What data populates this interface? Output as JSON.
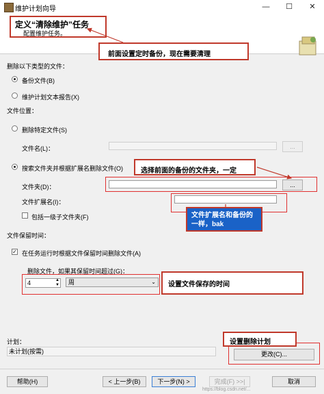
{
  "window": {
    "title": "维护计划向导",
    "minimize": "—",
    "maximize": "☐",
    "close": "✕"
  },
  "header": {
    "title": "定义“清除维护”任务",
    "subtitle": "配置维护任务。"
  },
  "annotations": {
    "top_note": "前面设置定时备份，现在需要清理",
    "folder_note": "选择前面的备份的文件夹，一定",
    "extension_note": "文件扩展名和备份的一样，bak",
    "retention_note": "设置文件保存的时间",
    "schedule_note": "设置删除计划",
    "accent_color": "#c0392b",
    "blue_color": "#1a62c7"
  },
  "form": {
    "delete_type_label": "删除以下类型的文件：",
    "backup_files_label": "备份文件(B)",
    "report_files_label": "维护计划文本报告(X)",
    "file_location_label": "文件位置：",
    "delete_specific_label": "删除特定文件(S)",
    "file_name_label": "文件名(L)：",
    "file_name_value": "",
    "search_folder_label": "搜索文件夹并根据扩展名删除文件(O)",
    "folder_label": "文件夹(D)：",
    "folder_value": "",
    "extension_label": "文件扩展名(I)：",
    "extension_value": "",
    "include_subfolders_label": "包括一级子文件夹(F)",
    "browse_label": "...",
    "file_age_label": "文件保留时间：",
    "delete_by_age_label": "在任务运行时根据文件保留时间删除文件(A)",
    "delete_older_label": "删除文件，如果其保留时间超过(G)：",
    "age_number": "4",
    "age_unit": "周"
  },
  "schedule": {
    "label": "计划：",
    "value": "未计划(按需)",
    "change_button": "更改(C)..."
  },
  "footer": {
    "help": "帮助(H)",
    "back": "< 上一步(B)",
    "next": "下一步(N) >",
    "finish": "完成(F) >>|",
    "cancel": "取消",
    "watermark": "https://blog.csdn.net/..."
  }
}
